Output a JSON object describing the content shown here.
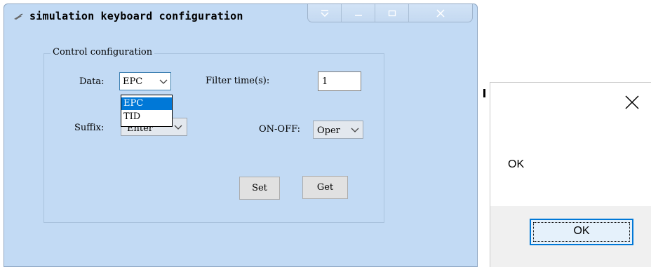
{
  "window": {
    "title": "simulation keyboard configuration",
    "icon": "keyboard-icon",
    "caption_buttons": [
      "dropdown-icon",
      "minimize-icon",
      "maximize-icon",
      "close-icon"
    ]
  },
  "group": {
    "label": "Control configuration"
  },
  "fields": {
    "data_label": "Data:",
    "data_value": "EPC",
    "data_options": [
      "EPC",
      "TID"
    ],
    "filter_label": "Filter time(s):",
    "filter_value": "1",
    "suffix_label": "Suffix:",
    "suffix_value": "Enter",
    "onoff_label": "ON-OFF:",
    "onoff_value": "Oper"
  },
  "buttons": {
    "set": "Set",
    "get": "Get"
  },
  "message_box": {
    "text": "OK",
    "ok_label": "OK",
    "close_icon": "close-icon"
  },
  "colors": {
    "window_bg": "#c2daf4",
    "selection": "#0078d7",
    "ok_border": "#0078d7"
  }
}
